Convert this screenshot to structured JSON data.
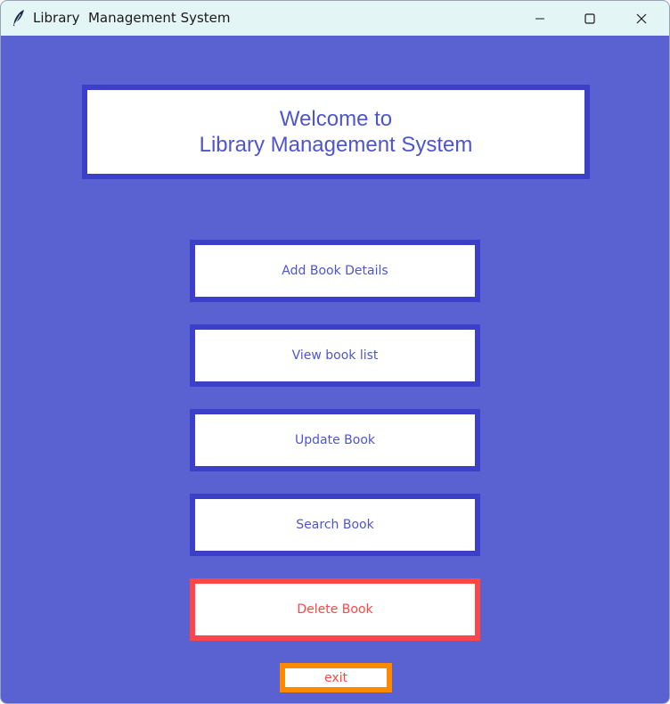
{
  "window": {
    "title": "Library  Management System",
    "icon": "feather-icon",
    "controls": [
      "minimize-icon",
      "maximize-icon",
      "close-icon"
    ]
  },
  "banner": {
    "line1": "Welcome to",
    "line2": "Library Management System"
  },
  "menu": {
    "add_label": "Add Book Details",
    "view_label": "View book list",
    "update_label": "Update Book",
    "search_label": "Search Book",
    "delete_label": "Delete Book",
    "exit_label": "exit"
  },
  "colors": {
    "background": "#5a61d0",
    "border": "#3c3fc8",
    "text": "#4f55cf",
    "delete": "#ff4545",
    "exit_border": "#ff8a00",
    "titlebar": "#e3f5f4"
  }
}
